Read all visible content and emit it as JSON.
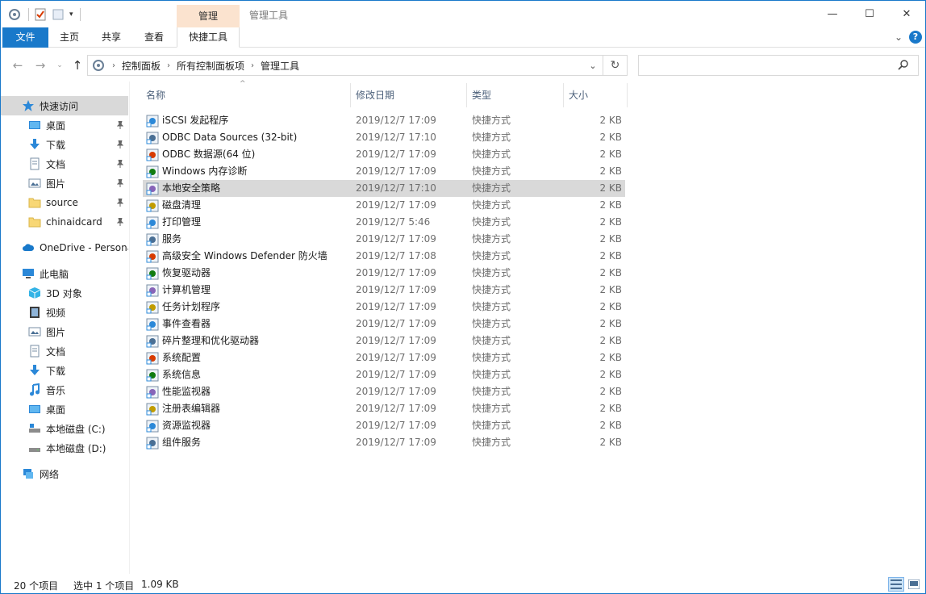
{
  "titlebar": {
    "context_header": "管理",
    "title": "管理工具",
    "minimize": "—",
    "maximize": "☐",
    "close": "✕"
  },
  "ribbon": {
    "tabs": [
      "文件",
      "主页",
      "共享",
      "查看",
      "快捷工具"
    ],
    "expand_glyph": "⌄",
    "help": "?"
  },
  "address": {
    "crumbs": [
      "控制面板",
      "所有控制面板项",
      "管理工具"
    ],
    "dropdown_glyph": "⌄",
    "refresh_glyph": "↻"
  },
  "search": {
    "placeholder": ""
  },
  "nav": {
    "quick_access": "快速访问",
    "quick_items": [
      "桌面",
      "下载",
      "文档",
      "图片",
      "source",
      "chinaidcard"
    ],
    "onedrive": "OneDrive - Persona",
    "this_pc": "此电脑",
    "pc_items": [
      "3D 对象",
      "视频",
      "图片",
      "文档",
      "下载",
      "音乐",
      "桌面",
      "本地磁盘 (C:)",
      "本地磁盘 (D:)"
    ],
    "network": "网络"
  },
  "columns": {
    "name": "名称",
    "date": "修改日期",
    "type": "类型",
    "size": "大小",
    "sort_glyph": "^"
  },
  "files": [
    {
      "name": "iSCSI 发起程序",
      "date": "2019/12/7 17:09",
      "type": "快捷方式",
      "size": "2 KB",
      "icon": "iscsi-icon"
    },
    {
      "name": "ODBC Data Sources (32-bit)",
      "date": "2019/12/7 17:10",
      "type": "快捷方式",
      "size": "2 KB",
      "icon": "odbc-icon"
    },
    {
      "name": "ODBC 数据源(64 位)",
      "date": "2019/12/7 17:09",
      "type": "快捷方式",
      "size": "2 KB",
      "icon": "odbc-icon"
    },
    {
      "name": "Windows 内存诊断",
      "date": "2019/12/7 17:09",
      "type": "快捷方式",
      "size": "2 KB",
      "icon": "memory-diagnostic-icon"
    },
    {
      "name": "本地安全策略",
      "date": "2019/12/7 17:10",
      "type": "快捷方式",
      "size": "2 KB",
      "icon": "security-policy-icon"
    },
    {
      "name": "磁盘清理",
      "date": "2019/12/7 17:09",
      "type": "快捷方式",
      "size": "2 KB",
      "icon": "disk-cleanup-icon"
    },
    {
      "name": "打印管理",
      "date": "2019/12/7 5:46",
      "type": "快捷方式",
      "size": "2 KB",
      "icon": "print-management-icon"
    },
    {
      "name": "服务",
      "date": "2019/12/7 17:09",
      "type": "快捷方式",
      "size": "2 KB",
      "icon": "services-icon"
    },
    {
      "name": "高级安全 Windows Defender 防火墙",
      "date": "2019/12/7 17:08",
      "type": "快捷方式",
      "size": "2 KB",
      "icon": "firewall-icon"
    },
    {
      "name": "恢复驱动器",
      "date": "2019/12/7 17:09",
      "type": "快捷方式",
      "size": "2 KB",
      "icon": "recovery-drive-icon"
    },
    {
      "name": "计算机管理",
      "date": "2019/12/7 17:09",
      "type": "快捷方式",
      "size": "2 KB",
      "icon": "computer-management-icon"
    },
    {
      "name": "任务计划程序",
      "date": "2019/12/7 17:09",
      "type": "快捷方式",
      "size": "2 KB",
      "icon": "task-scheduler-icon"
    },
    {
      "name": "事件查看器",
      "date": "2019/12/7 17:09",
      "type": "快捷方式",
      "size": "2 KB",
      "icon": "event-viewer-icon"
    },
    {
      "name": "碎片整理和优化驱动器",
      "date": "2019/12/7 17:09",
      "type": "快捷方式",
      "size": "2 KB",
      "icon": "defrag-icon"
    },
    {
      "name": "系统配置",
      "date": "2019/12/7 17:09",
      "type": "快捷方式",
      "size": "2 KB",
      "icon": "system-config-icon"
    },
    {
      "name": "系统信息",
      "date": "2019/12/7 17:09",
      "type": "快捷方式",
      "size": "2 KB",
      "icon": "system-info-icon"
    },
    {
      "name": "性能监视器",
      "date": "2019/12/7 17:09",
      "type": "快捷方式",
      "size": "2 KB",
      "icon": "performance-monitor-icon"
    },
    {
      "name": "注册表编辑器",
      "date": "2019/12/7 17:09",
      "type": "快捷方式",
      "size": "2 KB",
      "icon": "registry-editor-icon"
    },
    {
      "name": "资源监视器",
      "date": "2019/12/7 17:09",
      "type": "快捷方式",
      "size": "2 KB",
      "icon": "resource-monitor-icon"
    },
    {
      "name": "组件服务",
      "date": "2019/12/7 17:09",
      "type": "快捷方式",
      "size": "2 KB",
      "icon": "component-services-icon"
    }
  ],
  "selected_index": 4,
  "status": {
    "count": "20 个项目",
    "selection": "选中 1 个项目",
    "size": "1.09 KB"
  },
  "colors": {
    "accent": "#1979ca",
    "context_tab": "#fbe3cf",
    "selection": "#d9d9d9"
  }
}
